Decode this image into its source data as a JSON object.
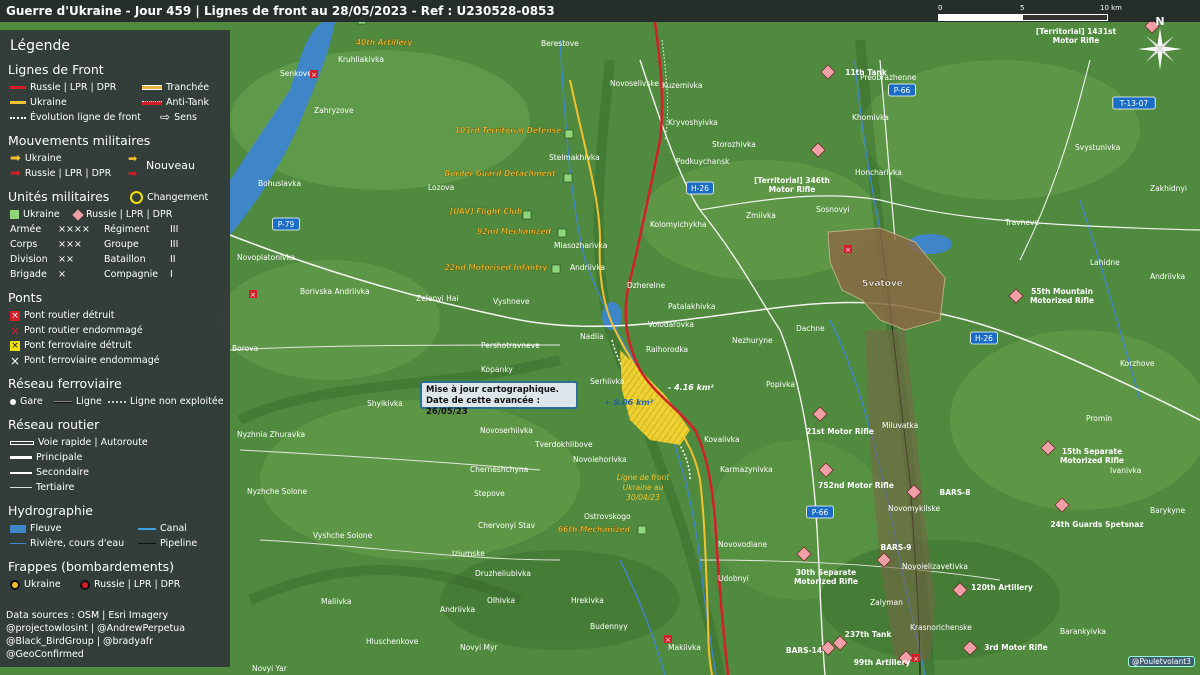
{
  "title": "Guerre d'Ukraine - Jour 459 | Lignes de front au 28/05/2023 - Ref : U230528-0853",
  "legend": {
    "heading": "Légende",
    "front_lines": {
      "title": "Lignes de Front",
      "russia": "Russie | LPR | DPR",
      "trench": "Tranchée",
      "ukraine": "Ukraine",
      "anti_tank": "Anti-Tank",
      "evolution": "Évolution ligne de front",
      "direction": "Sens"
    },
    "movements": {
      "title": "Mouvements militaires",
      "ukraine": "Ukraine",
      "russia": "Russie | LPR | DPR",
      "new": "Nouveau"
    },
    "units": {
      "title": "Unités militaires",
      "change": "Changement",
      "ukraine": "Ukraine",
      "russia": "Russie | LPR | DPR",
      "sizes": [
        {
          "name": "Armée",
          "sym": "××××",
          "name2": "Régiment",
          "sym2": "III"
        },
        {
          "name": "Corps",
          "sym": "×××",
          "name2": "Groupe",
          "sym2": "III"
        },
        {
          "name": "Division",
          "sym": "××",
          "name2": "Bataillon",
          "sym2": "II"
        },
        {
          "name": "Brigade",
          "sym": "×",
          "name2": "Compagnie",
          "sym2": "I"
        }
      ]
    },
    "bridges": {
      "title": "Ponts",
      "road_destroyed": "Pont routier détruit",
      "road_damaged": "Pont routier endommagé",
      "rail_destroyed": "Pont ferroviaire détruit",
      "rail_damaged": "Pont ferroviaire endommagé"
    },
    "rail": {
      "title": "Réseau ferroviaire",
      "station": "Gare",
      "line": "Ligne",
      "unused": "Ligne non exploitée"
    },
    "roads": {
      "title": "Réseau routier",
      "highway": "Voie rapide | Autoroute",
      "main": "Principale",
      "secondary": "Secondaire",
      "tertiary": "Tertiaire"
    },
    "hydro": {
      "title": "Hydrographie",
      "river_large": "Fleuve",
      "canal": "Canal",
      "river": "Rivière, cours d'eau",
      "pipeline": "Pipeline"
    },
    "strikes": {
      "title": "Frappes (bombardements)",
      "ukraine": "Ukraine",
      "russia": "Russie | LPR | DPR"
    }
  },
  "credits": [
    "Data sources : OSM | Esri Imagery",
    "@projectowlosint | @AndrewPerpetua",
    "@Black_BirdGroup | @bradyafr",
    "@GeoConfirmed"
  ],
  "callout": {
    "line1": "Mise à jour cartographique.",
    "line2": "Date de cette avancée : 26/05/23"
  },
  "annotations": {
    "gain": "+ 9.06 km²",
    "loss": "- 4.16 km²",
    "old_line": [
      "Ligne de front",
      "Ukraine au",
      "30/04/23"
    ]
  },
  "scale": {
    "zero": "0",
    "mid": "5",
    "end": "10 km"
  },
  "compass": "N",
  "author": "@Pouletvolant3",
  "roads": [
    "P-79",
    "P-66",
    "H-26",
    "H-26",
    "P-66",
    "T-13-07"
  ],
  "towns": [
    "Berestove",
    "Kruhliakivka",
    "Senkove",
    "Zahryzove",
    "Novoselivske",
    "Kuzemivka",
    "Preobrazhenne",
    "Kryvoshyivka",
    "Stelmakhivka",
    "Storozhivka",
    "Podkuychansk",
    "Svystunivka",
    "Bohuslavka",
    "Lozova",
    "Khomivka",
    "Honcharivka",
    "Zmiivka",
    "Sosnovyi",
    "Zakhidnyi",
    "Kolomyichykha",
    "Miasozharivka",
    "Travneve",
    "Novoplatonivka",
    "Andriivka",
    "Lahidne",
    "Andriivka",
    "Dzherelne",
    "Svatove",
    "Borivska Andriivka",
    "Zelenyi Hai",
    "Vyshneve",
    "Patalakhivka",
    "Volodarovka",
    "Dachne",
    "Borova",
    "Pershotravneve",
    "Nezhuryne",
    "Raihorodka",
    "Nadiia",
    "Korzhove",
    "Kopanky",
    "Serhiivka",
    "Popivka",
    "Shyikivka",
    "Novoserhiivka",
    "Tverdokhlibove",
    "Kovalivka",
    "Miluvatka",
    "Promin",
    "Nyzhnia Zhuravka",
    "Novoiehorivka",
    "Karmazynivka",
    "Ivanivka",
    "Cherneshchyna",
    "Stepove",
    "Nyzhche Solone",
    "Novomykilske",
    "Chervonyi Stav",
    "Ostrovskogo",
    "Barykyne",
    "Vyshche Solone",
    "Novovodiane",
    "Iziumske",
    "Druzhelіubivka",
    "Udobnyi",
    "Novoielizavetivka",
    "Maliivka",
    "Andriivka",
    "Olhivka",
    "Hrekivka",
    "Zalyman",
    "Hluschenkove",
    "Budennyy",
    "Krasnorichenske",
    "Barankyivka",
    "Makiivka",
    "Novyi Myr",
    "Novyi Yar"
  ],
  "units": {
    "ukraine": [
      "40th Artillery",
      "103rd Territorial Defense",
      "Border Guard Detachment",
      "[UAV] Flight Club",
      "92nd Mechanized",
      "22nd Motorised Infantry",
      "66th Mechanized"
    ],
    "russia": [
      "11th Tank",
      "[Territorial] 1431st Motor Rifle",
      "[Territorial] 346th Motor Rifle",
      "55th Mountain Motorized Rifle",
      "21st Motor Rifle",
      "15th Separate Motorized Rifle",
      "752nd Motor Rifle",
      "BARS-8",
      "24th Guards Spetsnaz",
      "BARS-9",
      "30th Separate Motorized Rifle",
      "120th Artillery",
      "237th Tank",
      "BARS-14",
      "99th Artillery",
      "3rd Motor Rifle"
    ]
  },
  "colors": {
    "russia_line": "#d21f2a",
    "ukraine_line": "#f2c12e",
    "ukraine_unit": "#8fd67a",
    "russia_unit": "#f0a0a6",
    "water": "#3e86c8",
    "terrain": "#4f8a3e",
    "legend_bg": "#303438",
    "gain_area": "#f5d431"
  }
}
